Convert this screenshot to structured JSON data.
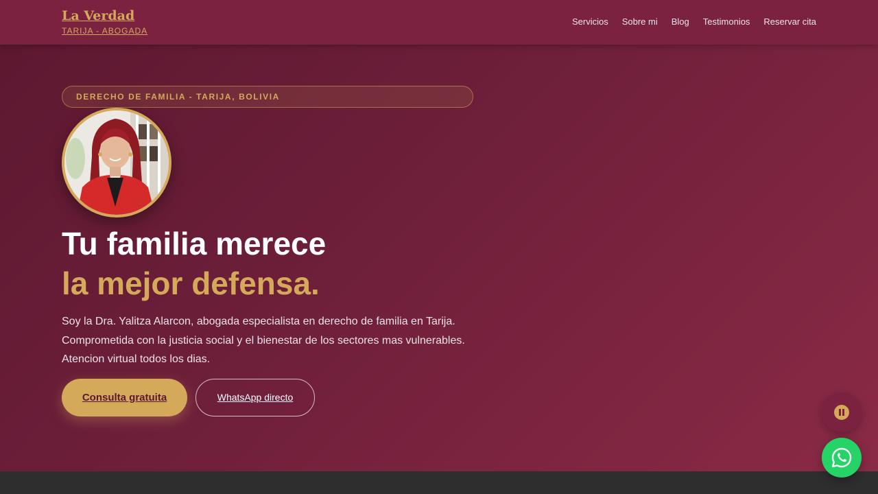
{
  "brand": {
    "name": "La Verdad",
    "subtitle": "TARIJA - ABOGADA"
  },
  "nav": {
    "items": [
      {
        "label": "Servicios"
      },
      {
        "label": "Sobre mi"
      },
      {
        "label": "Blog"
      },
      {
        "label": "Testimonios"
      },
      {
        "label": "Reservar cita"
      }
    ]
  },
  "hero": {
    "badge": "DERECHO DE FAMILIA - TARIJA, BOLIVIA",
    "headline_line1": "Tu familia merece",
    "headline_line2": "la mejor defensa.",
    "intro_line1": "Soy la Dra. Yalitza Alarcon, abogada especialista en derecho de familia en Tarija.",
    "intro_line2": "Comprometida con la justicia social y el bienestar de los sectores mas vulnerables.",
    "intro_line3": "Atencion virtual todos los dias.",
    "primary_cta": "Consulta gratuita",
    "secondary_cta": "WhatsApp directo"
  },
  "fabs": {
    "pause_icon": "pause-icon",
    "whatsapp_icon": "whatsapp-icon"
  },
  "colors": {
    "brand_maroon": "#7a2240",
    "gold": "#d4a95a",
    "whatsapp_green": "#25d366"
  }
}
